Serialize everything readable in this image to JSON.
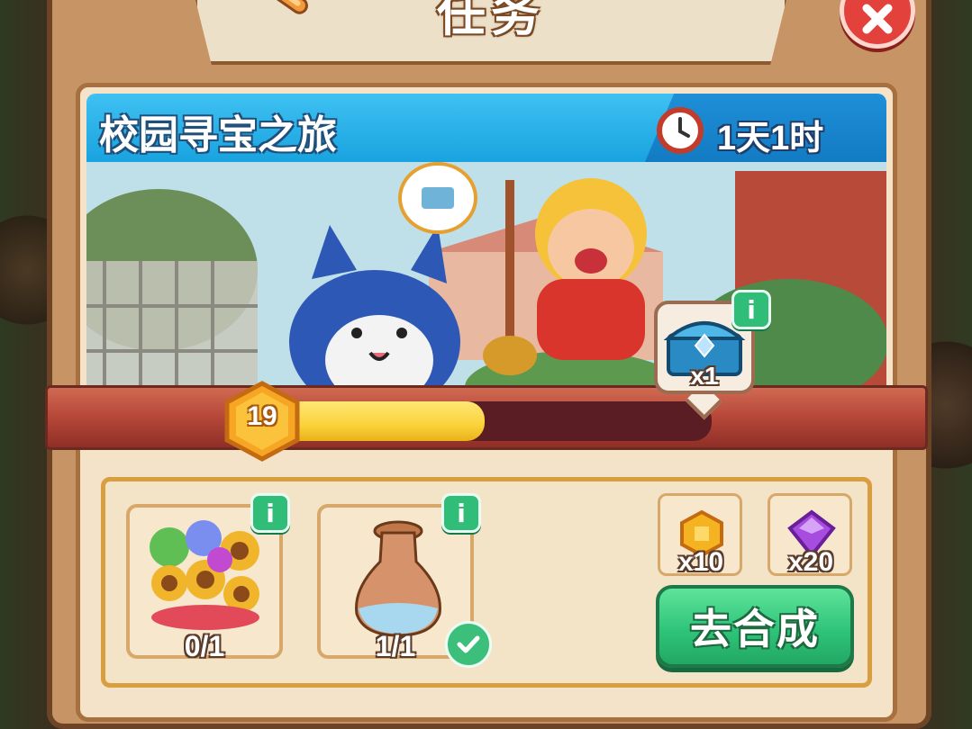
{
  "dialog": {
    "title": "任务"
  },
  "event": {
    "name": "校园寻宝之旅",
    "time_remaining": "1天1时",
    "level": "19",
    "progress": 0.49,
    "reward": {
      "icon": "treasure-chest-icon",
      "count": "x1"
    }
  },
  "requirements": [
    {
      "icon": "flower-bouquet-icon",
      "count": "0/1",
      "completed": false
    },
    {
      "icon": "vase-icon",
      "count": "1/1",
      "completed": true
    }
  ],
  "task_rewards": [
    {
      "icon": "gold-coin-icon",
      "count": "x10",
      "color": "#f5b321"
    },
    {
      "icon": "purple-gem-icon",
      "count": "x20",
      "color": "#a64de0"
    }
  ],
  "actions": {
    "merge_label": "去合成"
  },
  "colors": {
    "header_blue": "#19a3df",
    "button_green": "#2fc47a",
    "close_red": "#e2413c",
    "progress_yellow": "#fbd23a"
  }
}
